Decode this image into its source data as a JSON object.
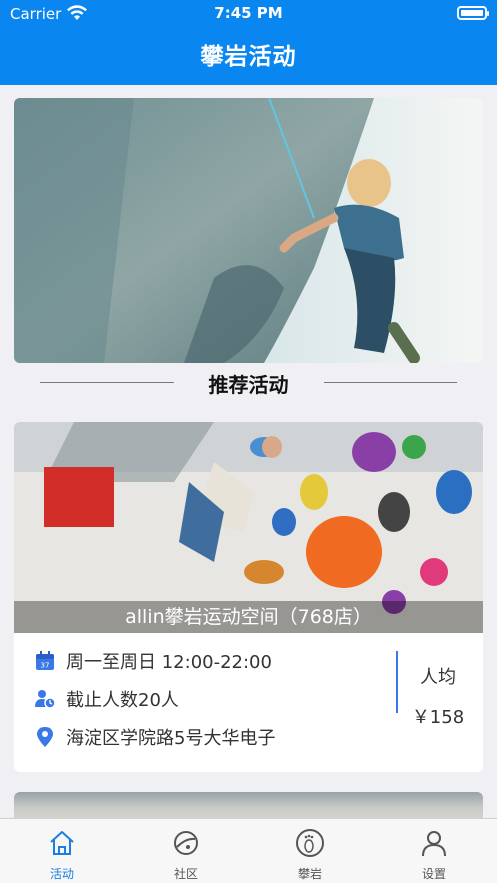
{
  "status_bar": {
    "carrier": "Carrier",
    "time": "7:45 PM"
  },
  "header": {
    "title": "攀岩活动"
  },
  "section": {
    "title": "推荐活动"
  },
  "activity": {
    "name": "allin攀岩运动空间（768店）",
    "hours": "周一至周日 12:00-22:00",
    "capacity": "截止人数20人",
    "address": "海淀区学院路5号大华电子",
    "price_label": "人均",
    "price": "￥158"
  },
  "tabs": [
    {
      "label": "活动",
      "icon": "home-icon",
      "active": true
    },
    {
      "label": "社区",
      "icon": "planet-icon",
      "active": false
    },
    {
      "label": "攀岩",
      "icon": "footprint-icon",
      "active": false
    },
    {
      "label": "设置",
      "icon": "user-icon",
      "active": false
    }
  ],
  "colors": {
    "accent": "#0a86f0",
    "tab_active": "#1a7fe0",
    "divider": "#3b78e7"
  }
}
